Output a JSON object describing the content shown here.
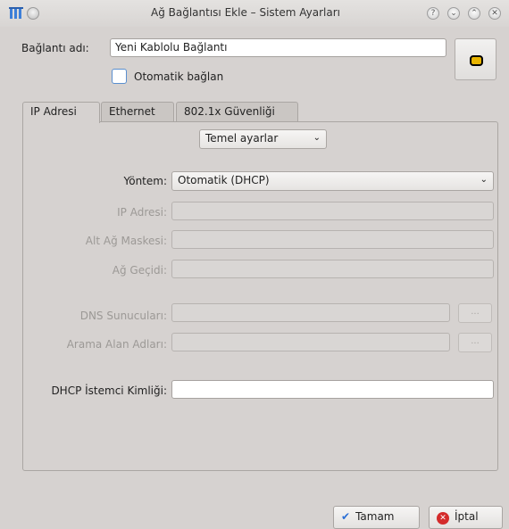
{
  "window": {
    "title": "Ağ Bağlantısı Ekle – Sistem Ayarları",
    "controls": [
      "help-icon",
      "minimize-icon",
      "maximize-icon",
      "close-icon"
    ]
  },
  "connection": {
    "name_label": "Bağlantı adı:",
    "name_value": "Yeni Kablolu Bağlantı",
    "auto_connect_label": "Otomatik bağlan",
    "auto_connect_checked": false,
    "icon": "wired-network-icon"
  },
  "tabs": [
    {
      "label": "IP Adresi",
      "active": true
    },
    {
      "label": "Ethernet",
      "active": false
    },
    {
      "label": "802.1x Güvenliği",
      "active": false
    }
  ],
  "ip_settings": {
    "mode_combo": "Temel ayarlar",
    "method_label": "Yöntem:",
    "method_value": "Otomatik (DHCP)",
    "ip_label": "IP Adresi:",
    "mask_label": "Alt Ağ Maskesi:",
    "gateway_label": "Ağ Geçidi:",
    "dns_label": "DNS Sunucuları:",
    "search_label": "Arama Alan Adları:",
    "ellipsis": "...",
    "dhcp_id_label": "DHCP İstemci Kimliği:",
    "dhcp_id_value": ""
  },
  "buttons": {
    "ok": "Tamam",
    "cancel": "İptal"
  },
  "colors": {
    "window_bg": "#d6d2d0",
    "disabled_text": "#9c9996",
    "ok_check": "#2a6fd6",
    "cancel_red": "#d42b2b"
  }
}
